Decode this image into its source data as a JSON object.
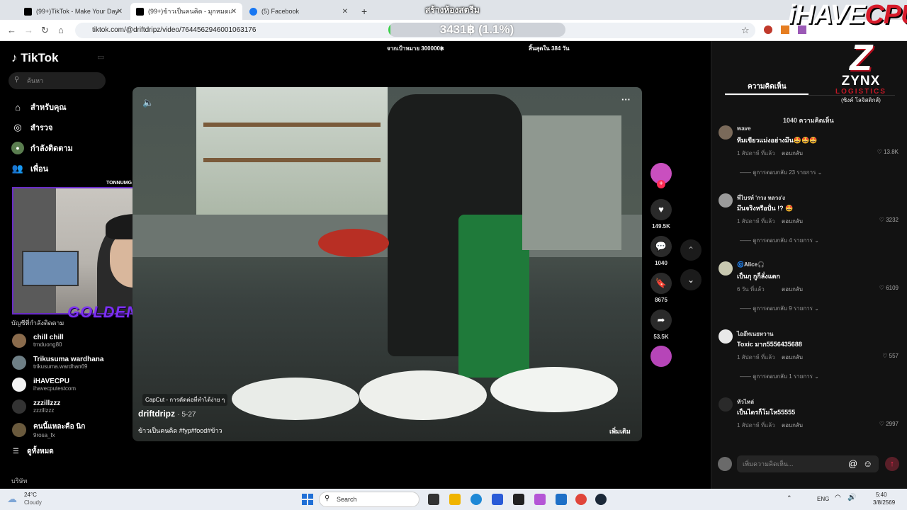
{
  "browser": {
    "tabs": [
      {
        "title": "(99+)TikTok - Make Your Day",
        "color": "#000000"
      },
      {
        "title": "(99+)ข้าวเป็นคนคิด - มุกหมดเสร็จ",
        "color": "#000000"
      },
      {
        "title": "(5) Facebook",
        "color": "#1877f2"
      }
    ],
    "url": "tiktok.com/@driftdripz/video/7644562946001063176"
  },
  "overlay": {
    "stream_title": "สร้างห้องสตรีม",
    "goal_text": "3431฿ (1.1%)",
    "goal_progress": 0.011,
    "goal_target": "จากเป้าหมาย 300000฿",
    "goal_remaining": "สิ้นสุดใน 384 วัน",
    "brand_left": "iHAVE",
    "brand_right": "CPU",
    "cam_name": "GOLDENJET",
    "cam_handle": "TONNUMG",
    "sponsor_name": "ZYNX",
    "sponsor_sub": "LOGISTICS",
    "sponsor_th": "(ซิงค์ โลจิสติกส์)"
  },
  "tiktok": {
    "logo": "TikTok",
    "search_placeholder": "ค้นหา",
    "nav": [
      {
        "label": "สำหรับคุณ",
        "icon": "home-icon"
      },
      {
        "label": "สำรวจ",
        "icon": "compass-icon"
      },
      {
        "label": "กำลังติดตาม",
        "icon": "following-icon"
      },
      {
        "label": "เพื่อน",
        "icon": "friends-icon"
      }
    ],
    "following_title": "บัญชีที่กำลังติดตาม",
    "following": [
      {
        "name": "chill chill",
        "user": "trnduong80",
        "color": "#8a6b4c"
      },
      {
        "name": "Trikusuma wardhana",
        "user": "trikusuma.wardhan69",
        "color": "#6e7f86"
      },
      {
        "name": "iHAVECPU",
        "user": "ihavecputestcom",
        "color": "#f2f2f2"
      },
      {
        "name": "zzzillzzz",
        "user": "zzzillzzz",
        "color": "#333333"
      },
      {
        "name": "คนนี้แหละคือ นิก",
        "user": "9rosa_fx",
        "color": "#6a5a3d"
      }
    ],
    "see_all": "ดูทั้งหมด",
    "company": "บริษัท"
  },
  "video": {
    "author": "driftdripz",
    "date": "· 5-27",
    "caption": "ข้าวเป็นคนคิด #fyp#food#ข้าว",
    "capcut": "CapCut - การตัดต่อที่ทำได้ง่าย ๆ",
    "more": "เพิ่มเติม",
    "actions": {
      "likes": "149.5K",
      "comments": "1040",
      "saves": "8675",
      "shares": "53.5K"
    }
  },
  "comments": {
    "tab": "ความคิดเห็น",
    "count": "1040 ความคิดเห็น",
    "reply_label": "ตอบกลับ",
    "items": [
      {
        "user": "wave",
        "text": "ทีมเขียวแม่งอย่างมึน🤩🤩🤩",
        "time": "1 สัปดาห์ ที่แล้ว",
        "likes": "13.8K",
        "replies": "ดูการตอบกลับ 23 รายการ ⌄",
        "color": "#7a6a5a"
      },
      {
        "user": "พี่ไบรท์ 'กวง หลวง'ง",
        "text": "มึนจริงหรือปั่น !? 🤩",
        "time": "1 สัปดาห์ ที่แล้ว",
        "likes": "3232",
        "replies": "ดูการตอบกลับ 4 รายการ ⌄",
        "color": "#9a9a9a"
      },
      {
        "user": "🌀Alice🎧",
        "text": "เป็นกุ กูก็ลั่งแตก",
        "time": "6 วัน ที่แล้ว",
        "likes": "6109",
        "replies": "ดูการตอบกลับ 9 รายการ ⌄",
        "color": "#c8c8b0"
      },
      {
        "user": "ไออ๊ทเนยหวาน",
        "text": "Toxic มาก5556435688",
        "time": "1 สัปดาห์ ที่แล้ว",
        "likes": "557",
        "replies": "ดูการตอบกลับ 1 รายการ ⌄",
        "color": "#e8e8e8"
      },
      {
        "user": "หัวไหล่",
        "text": "เป็นไดรก็โมโห55555",
        "time": "1 สัปดาห์ ที่แล้ว",
        "likes": "2997",
        "replies": "",
        "color": "#2a2a2a"
      }
    ],
    "input_placeholder": "เพิ่มความคิดเห็น..."
  },
  "taskbar": {
    "weather_temp": "24°C",
    "weather_desc": "Cloudy",
    "search": "Search",
    "lang": "ENG",
    "time": "5:40",
    "date": "3/8/2569"
  }
}
